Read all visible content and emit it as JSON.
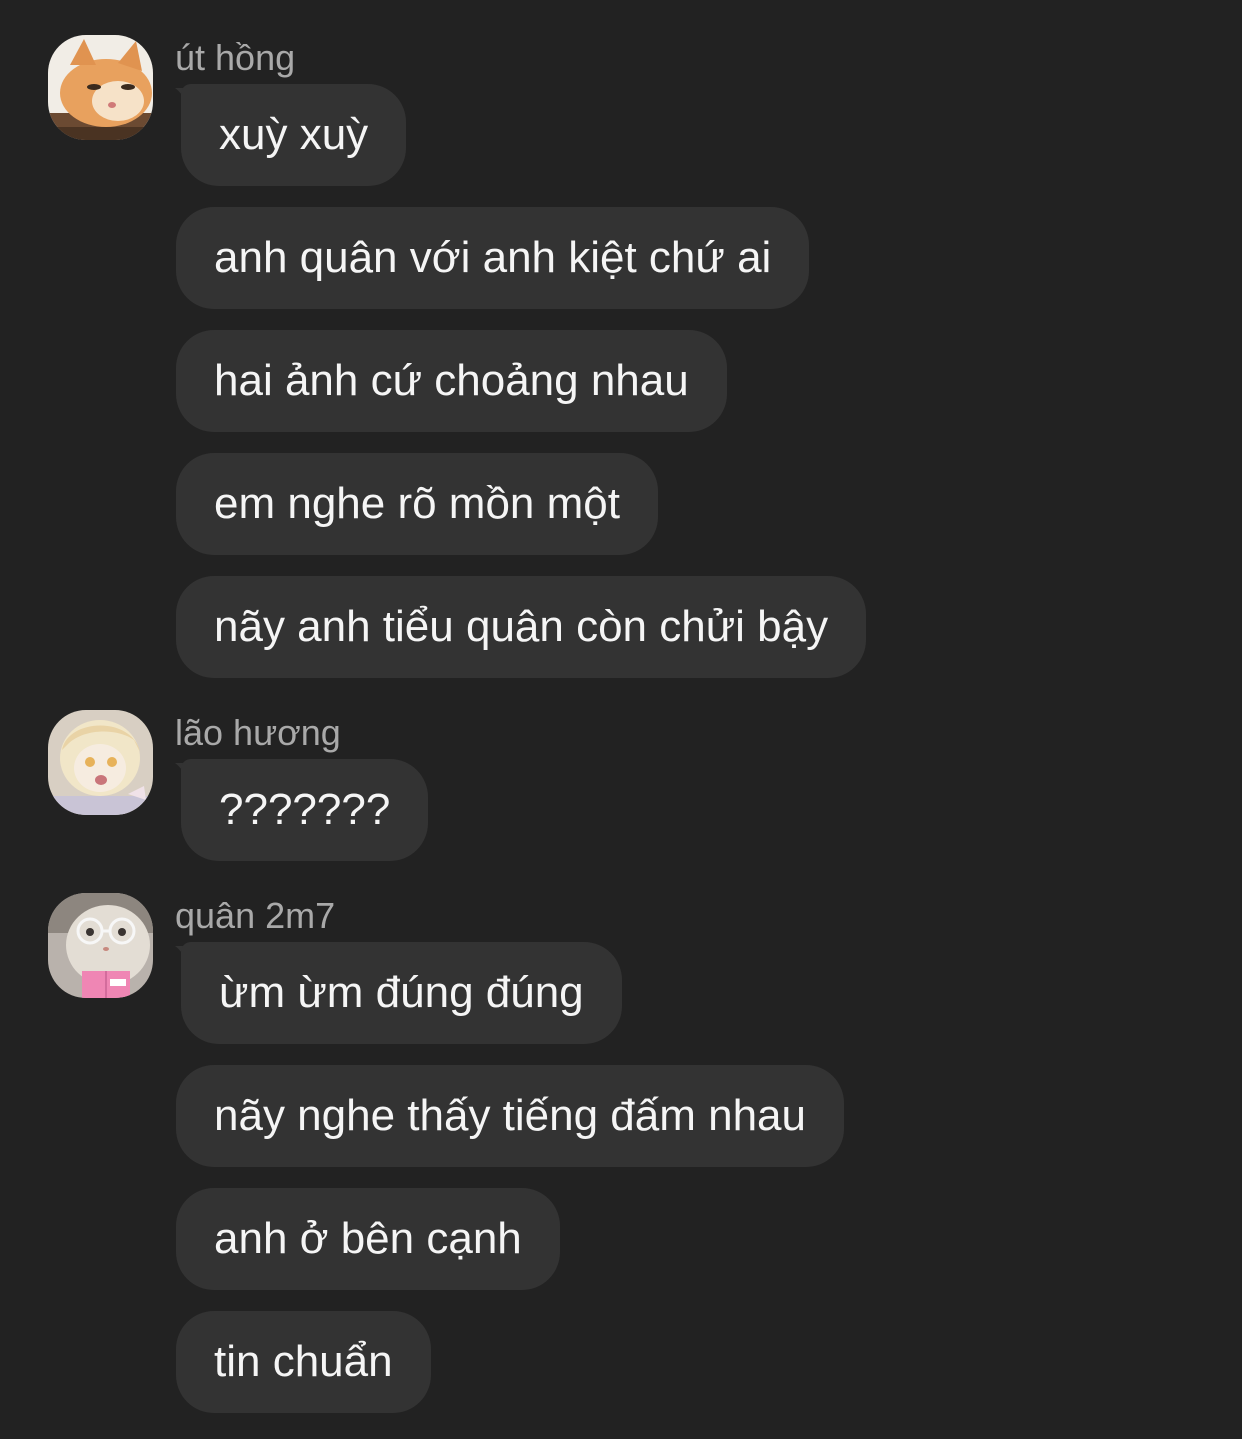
{
  "groups": [
    {
      "sender": "út hồng",
      "avatar_icon": "cat-avatar-icon",
      "messages": [
        "xuỳ xuỳ",
        "anh quân với anh kiệt chứ ai",
        "hai ảnh cứ choảng nhau",
        "em nghe rõ mồn một",
        "nãy anh tiểu quân còn chửi bậy"
      ]
    },
    {
      "sender": "lão hương",
      "avatar_icon": "anime-girl-avatar-icon",
      "messages": [
        "???????"
      ]
    },
    {
      "sender": "quân 2m7",
      "avatar_icon": "hamster-glasses-avatar-icon",
      "messages": [
        "ừm ừm đúng đúng",
        "nãy nghe thấy tiếng đấm nhau",
        "anh ở bên cạnh",
        "tin chuẩn"
      ]
    }
  ],
  "colors": {
    "background": "#222222",
    "bubble": "#333333",
    "text": "#f5f5f5",
    "sender": "#a9a9a9"
  }
}
